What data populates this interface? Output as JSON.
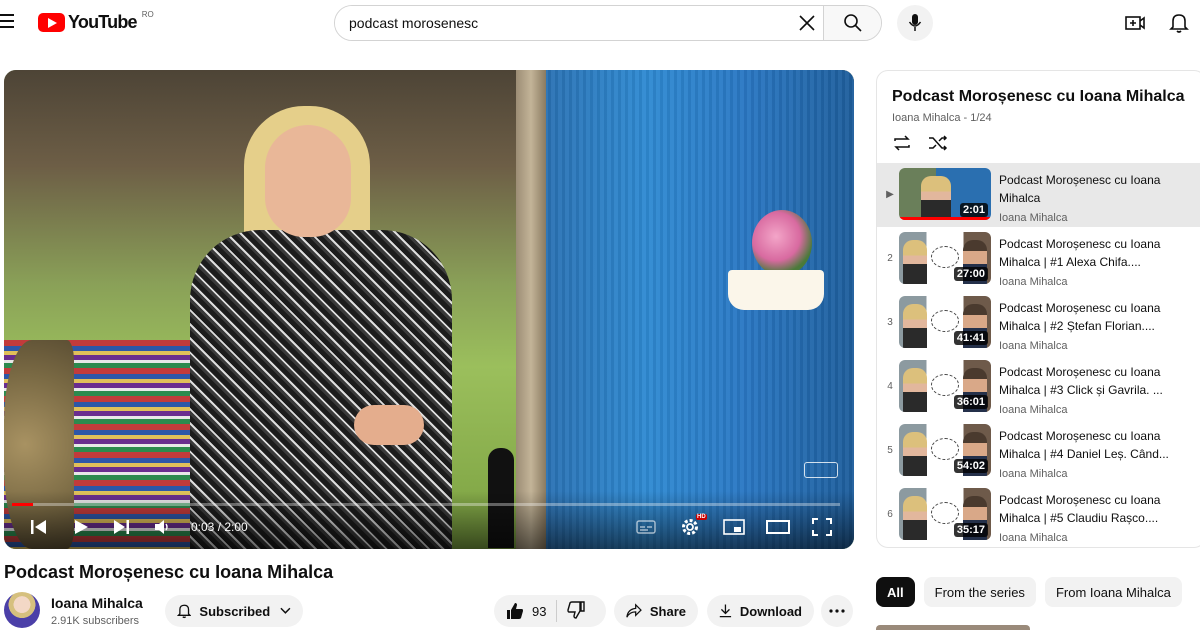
{
  "brand": {
    "logo_text": "YouTube",
    "country": "RO"
  },
  "search": {
    "value": "podcast morosenesc"
  },
  "player": {
    "time": "0:03 / 2:00",
    "progress_fraction": 0.025,
    "hd_badge": "HD"
  },
  "video": {
    "title": "Podcast Moroșenesc cu Ioana Mihalca",
    "channel": "Ioana Mihalca",
    "subscribers": "2.91K subscribers",
    "subscribe_label": "Subscribed",
    "likes": "93",
    "share_label": "Share",
    "download_label": "Download"
  },
  "playlist": {
    "title": "Podcast Moroșenesc cu Ioana Mihalca",
    "meta": "Ioana Mihalca - 1/24",
    "items": [
      {
        "index": "▶",
        "title": "Podcast Moroșenesc cu Ioana Mihalca",
        "channel": "Ioana Mihalca",
        "duration": "2:01"
      },
      {
        "index": "2",
        "title": "Podcast Moroșenesc cu Ioana Mihalca | #1 Alexa Chifa....",
        "channel": "Ioana Mihalca",
        "duration": "27:00"
      },
      {
        "index": "3",
        "title": "Podcast Moroșenesc cu Ioana Mihalca | #2 Ștefan Florian....",
        "channel": "Ioana Mihalca",
        "duration": "41:41"
      },
      {
        "index": "4",
        "title": "Podcast Moroșenesc cu Ioana Mihalca | #3 Click și Gavrila. ...",
        "channel": "Ioana Mihalca",
        "duration": "36:01"
      },
      {
        "index": "5",
        "title": "Podcast Moroșenesc cu Ioana Mihalca | #4 Daniel Leș. Când...",
        "channel": "Ioana Mihalca",
        "duration": "54:02"
      },
      {
        "index": "6",
        "title": "Podcast Moroșenesc cu Ioana Mihalca | #5 Claudiu Rașco....",
        "channel": "Ioana Mihalca",
        "duration": "35:17"
      }
    ]
  },
  "chips": [
    "All",
    "From the series",
    "From Ioana Mihalca"
  ]
}
